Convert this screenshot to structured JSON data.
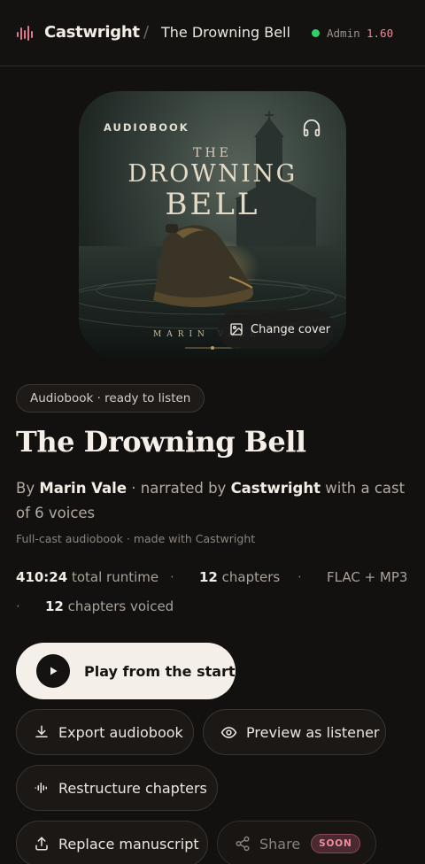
{
  "header": {
    "brand": "Castwright",
    "separator": "/",
    "book_title": "The Drowning Bell",
    "role": "Admin",
    "version": "1.60"
  },
  "cover": {
    "label": "AUDIOBOOK",
    "title_small": "THE",
    "title_line1": "DROWNING",
    "title_line2": "BELL",
    "author": "MARIN VALE",
    "change_cover_label": "Change cover"
  },
  "status_pill": "Audiobook · ready to listen",
  "title": "The Drowning Bell",
  "byline": {
    "by": "By",
    "author": "Marin Vale",
    "narrated": "· narrated by",
    "narrator": "Castwright",
    "cast": "with a cast of 6 voices"
  },
  "subline": "Full-cast audiobook · made with Castwright",
  "stats": {
    "runtime_value": "410:24",
    "runtime_label": "total runtime",
    "chapters_value": "12",
    "chapters_label": "chapters",
    "formats": "FLAC + MP3",
    "voiced_value": "12",
    "voiced_label": "chapters voiced",
    "dot": "·"
  },
  "actions": {
    "play": "Play from the start",
    "export": "Export audiobook",
    "preview": "Preview as listener",
    "restructure": "Restructure chapters",
    "replace": "Replace manuscript",
    "share": "Share",
    "soon": "SOON"
  },
  "icons": {
    "brand": "waveform-logo-icon",
    "headphones": "headphones-icon",
    "image": "image-icon",
    "play": "play-icon",
    "download": "download-icon",
    "eye": "eye-icon",
    "waveform": "waveform-icon",
    "upload": "upload-icon",
    "share": "share-icon"
  },
  "colors": {
    "background": "#121110",
    "accent": "#e88b9a",
    "status_online": "#2fd06a",
    "primary_button": "#f4efe9"
  }
}
